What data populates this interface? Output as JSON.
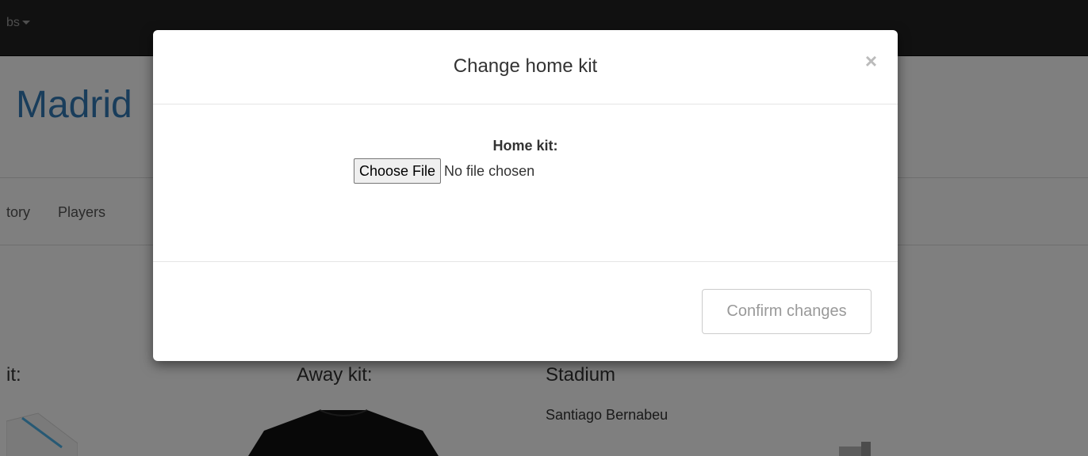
{
  "navbar": {
    "dropdown_label": "bs"
  },
  "page": {
    "team_title": "Madrid",
    "tabs": [
      "tory",
      "Players"
    ],
    "home_kit_label": "it:",
    "away_kit_label": "Away kit:",
    "stadium_label": "Stadium",
    "stadium_name": "Santiago Bernabeu"
  },
  "modal": {
    "title": "Change home kit",
    "close_symbol": "×",
    "field_label": "Home kit:",
    "choose_file_label": "Choose File",
    "file_status": "No file chosen",
    "confirm_label": "Confirm changes"
  },
  "colors": {
    "navbar": "#222222",
    "title_blue": "#337ab7",
    "backdrop": "rgba(0,0,0,0.5)"
  }
}
